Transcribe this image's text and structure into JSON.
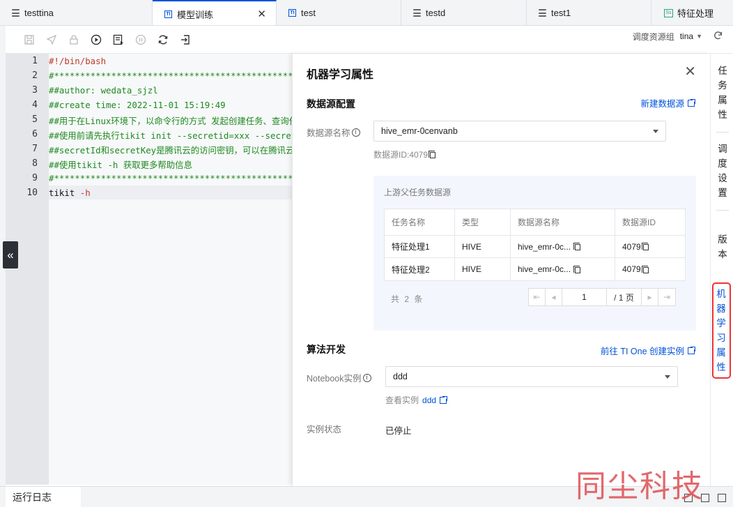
{
  "tabs": [
    {
      "label": "testtina",
      "icon": "file-stack-icon"
    },
    {
      "label": "模型训练",
      "icon": "ti-icon",
      "active": true
    },
    {
      "label": "test",
      "icon": "ti-icon"
    },
    {
      "label": "testd",
      "icon": "file-stack-icon"
    },
    {
      "label": "test1",
      "icon": "file-stack-icon"
    },
    {
      "label": "特征处理",
      "icon": "ss-icon"
    }
  ],
  "toolbar": {
    "resource_group_label": "调度资源组",
    "resource_group_value": "tina"
  },
  "editor": {
    "lines": [
      {
        "no": "1",
        "text": "#!/bin/bash",
        "color": "red"
      },
      {
        "no": "2",
        "text": "#********************************************************************************",
        "color": "green"
      },
      {
        "no": "3",
        "text": "##author: wedata_sjzl",
        "color": "green"
      },
      {
        "no": "4",
        "text": "##create time: 2022-11-01 15:19:49",
        "color": "green"
      },
      {
        "no": "5",
        "text": "##用于在Linux环境下，以命令行的方式 发起创建任务、查询任务",
        "color": "green"
      },
      {
        "no": "6",
        "text": "##使用前请先执行tikit init --secretid=xxx --secretkey=xxx",
        "color": "green"
      },
      {
        "no": "7",
        "text": "##secretId和secretKey是腾讯云的访问密钥，可以在腾讯云控制台",
        "color": "green"
      },
      {
        "no": "8",
        "text": "##使用tikit -h 获取更多帮助信息",
        "color": "green"
      },
      {
        "no": "9",
        "text": "#********************************************************************************",
        "color": "green"
      },
      {
        "no": "10",
        "text_a": "tikit ",
        "text_b": "-h",
        "color": "mixed"
      }
    ]
  },
  "panel": {
    "title": "机器学习属性",
    "datasource_section": "数据源配置",
    "new_datasource_link": "新建数据源",
    "datasource_name_label": "数据源名称",
    "datasource_name_value": "hive_emr-0cenvanb",
    "datasource_id_text": "数据源ID:4079",
    "upstream_title": "上游父任务数据源",
    "table": {
      "headers": [
        "任务名称",
        "类型",
        "数据源名称",
        "数据源ID"
      ],
      "rows": [
        [
          "特征处理1",
          "HIVE",
          "hive_emr-0c...",
          "4079"
        ],
        [
          "特征处理2",
          "HIVE",
          "hive_emr-0c...",
          "4079"
        ]
      ]
    },
    "total_text": "共 2 条",
    "pager": {
      "current": "1",
      "total": "/ 1 页"
    },
    "algo_section": "算法开发",
    "ti_link": "前往 TI One 创建实例",
    "notebook_label": "Notebook实例",
    "notebook_value": "ddd",
    "view_instance_label": "查看实例",
    "view_instance_link": "ddd",
    "status_label": "实例状态",
    "status_value": "已停止"
  },
  "rail": {
    "task_props": [
      "任",
      "务",
      "属",
      "性"
    ],
    "schedule": [
      "调",
      "度",
      "设",
      "置"
    ],
    "version": [
      "版",
      "本"
    ],
    "ml_props": [
      "机",
      "器",
      "学",
      "习",
      "属",
      "性"
    ]
  },
  "bottom": {
    "log_tab": "运行日志"
  },
  "watermark": "同尘科技",
  "colors": {
    "accent": "#0052d9",
    "highlight_border": "#ee3333",
    "code_green": "#1f8a1f",
    "code_red": "#c0392b"
  }
}
